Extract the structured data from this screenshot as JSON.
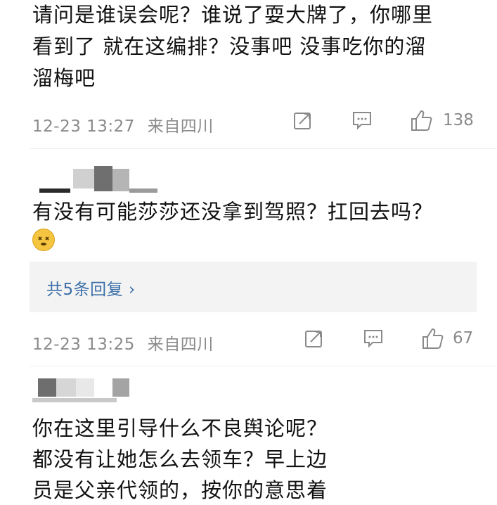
{
  "comment1": {
    "lines": [
      "请问是谁误会呢？谁说了耍大牌了，你哪里",
      "看到了 就在这编排？没事吧 没事吃你的溜",
      "溜梅吧"
    ],
    "time": "12-23 13:27",
    "source": "来自四川",
    "like_count": "138"
  },
  "comment2": {
    "lines": [
      "有没有可能莎莎还没拿到驾照？扛回去吗？"
    ],
    "emoji_icon": "dizzy-face-emoji",
    "reply_link": "共5条回复 ›",
    "time": "12-23 13:25",
    "source": "来自四川",
    "like_count": "67"
  },
  "comment3": {
    "lines": [
      "你在这里引导什么不良舆论呢？",
      "都没有让她怎么去领车？早上边",
      "员是父亲代领的，按你的意思着"
    ]
  },
  "colors": {
    "text": "#111111",
    "meta": "#8a8a8a",
    "link": "#3a6fa8",
    "reply_bg": "#f3f3f3"
  },
  "icons": {
    "repost": "repost-icon",
    "comment": "comment-icon",
    "like": "thumbs-up-icon"
  }
}
